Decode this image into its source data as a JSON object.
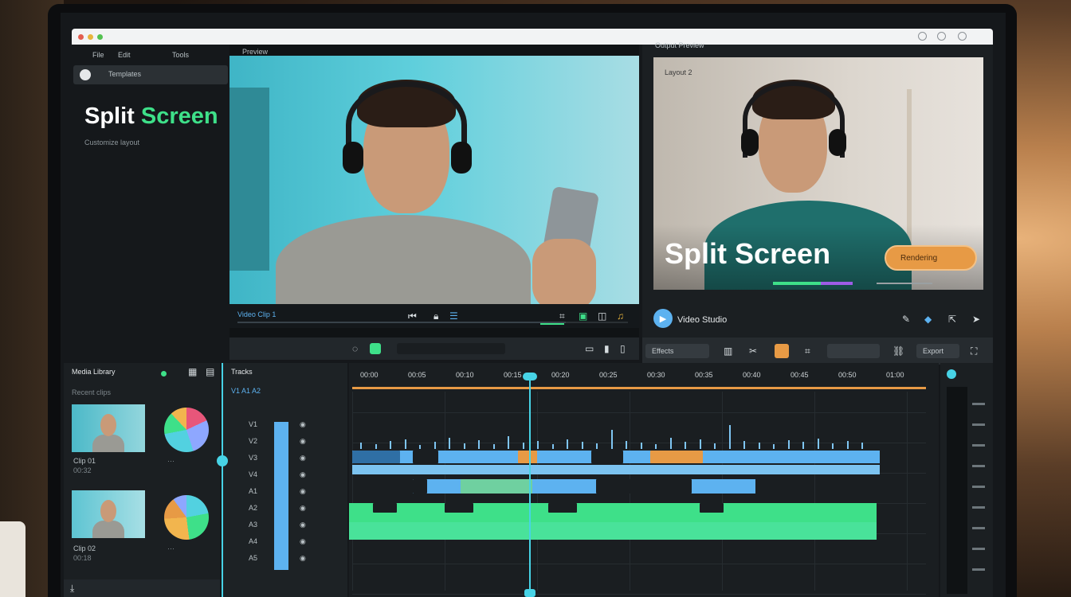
{
  "window": {
    "controls": [
      "close",
      "minimize",
      "maximize"
    ]
  },
  "left_panel": {
    "menu": [
      "File",
      "Edit",
      "Tools"
    ],
    "search_label": "Templates",
    "title_split": "Split",
    "title_screen": "Screen",
    "subtitle": "Customize layout"
  },
  "preview_left": {
    "header": "Preview",
    "footer_label": "Video Clip 1"
  },
  "preview_right": {
    "header": "Output Preview",
    "tag": "Layout 2",
    "overlay_title": "Split Screen",
    "button_label": "Rendering",
    "player_label": "Video Studio",
    "footer_buttons": [
      "Effects",
      "Export"
    ]
  },
  "media_panel": {
    "header": "Media Library",
    "sub": "Recent clips",
    "items": [
      {
        "label": "Clip 01",
        "sub": "00:32"
      },
      {
        "label": "Clip 02",
        "sub": "00:18"
      }
    ]
  },
  "track_panel": {
    "header": "Tracks",
    "sub": "V1  A1  A2",
    "rows": [
      "V1",
      "V2",
      "V3",
      "V4",
      "A1",
      "A2",
      "A3",
      "A4",
      "A5"
    ]
  },
  "timeline": {
    "ruler": [
      "00:00",
      "00:05",
      "00:10",
      "00:15",
      "00:20",
      "00:25",
      "00:30",
      "00:35",
      "00:40",
      "00:45",
      "00:50",
      "01:00"
    ]
  },
  "colors": {
    "accent_green": "#3ee089",
    "accent_blue": "#5db2f0",
    "accent_orange": "#e79a45",
    "playhead": "#47d3e6"
  }
}
